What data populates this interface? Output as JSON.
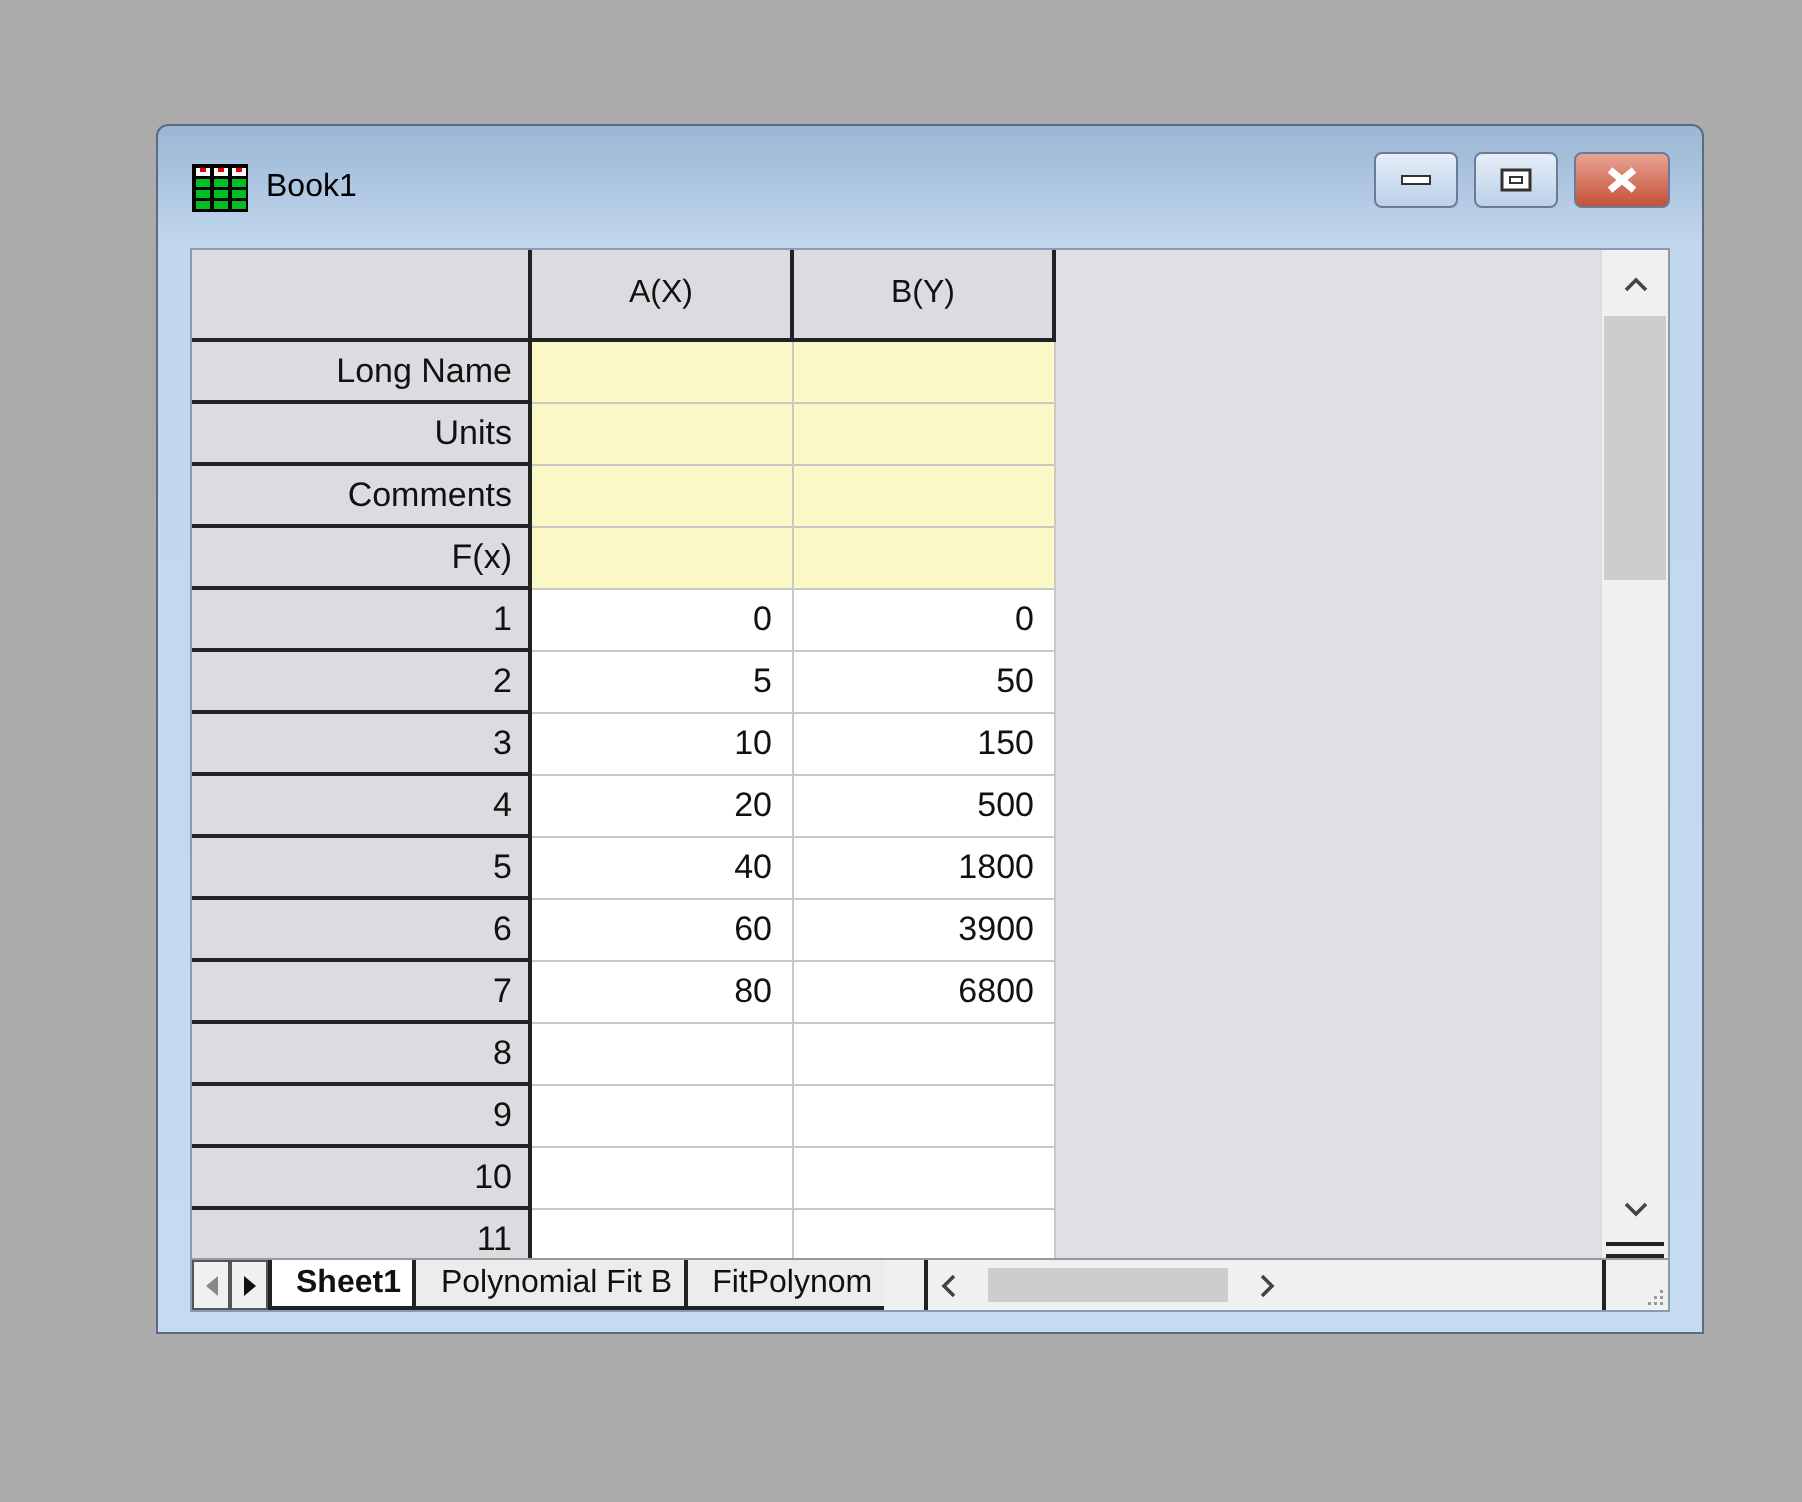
{
  "window": {
    "title": "Book1"
  },
  "columns": [
    "A(X)",
    "B(Y)"
  ],
  "label_rows": [
    {
      "label": "Long Name",
      "cells": [
        "",
        ""
      ]
    },
    {
      "label": "Units",
      "cells": [
        "",
        ""
      ]
    },
    {
      "label": "Comments",
      "cells": [
        "",
        ""
      ]
    },
    {
      "label": "F(x)",
      "cells": [
        "",
        ""
      ]
    }
  ],
  "rows": [
    {
      "label": "1",
      "cells": [
        "0",
        "0"
      ]
    },
    {
      "label": "2",
      "cells": [
        "5",
        "50"
      ]
    },
    {
      "label": "3",
      "cells": [
        "10",
        "150"
      ]
    },
    {
      "label": "4",
      "cells": [
        "20",
        "500"
      ]
    },
    {
      "label": "5",
      "cells": [
        "40",
        "1800"
      ]
    },
    {
      "label": "6",
      "cells": [
        "60",
        "3900"
      ]
    },
    {
      "label": "7",
      "cells": [
        "80",
        "6800"
      ]
    },
    {
      "label": "8",
      "cells": [
        "",
        ""
      ]
    },
    {
      "label": "9",
      "cells": [
        "",
        ""
      ]
    },
    {
      "label": "10",
      "cells": [
        "",
        ""
      ]
    },
    {
      "label": "11",
      "cells": [
        "",
        ""
      ]
    }
  ],
  "sheet_tabs": [
    {
      "label": "Sheet1",
      "selected": true
    },
    {
      "label": "Polynomial Fit B",
      "selected": false
    },
    {
      "label": "FitPolynom",
      "selected": false
    }
  ]
}
